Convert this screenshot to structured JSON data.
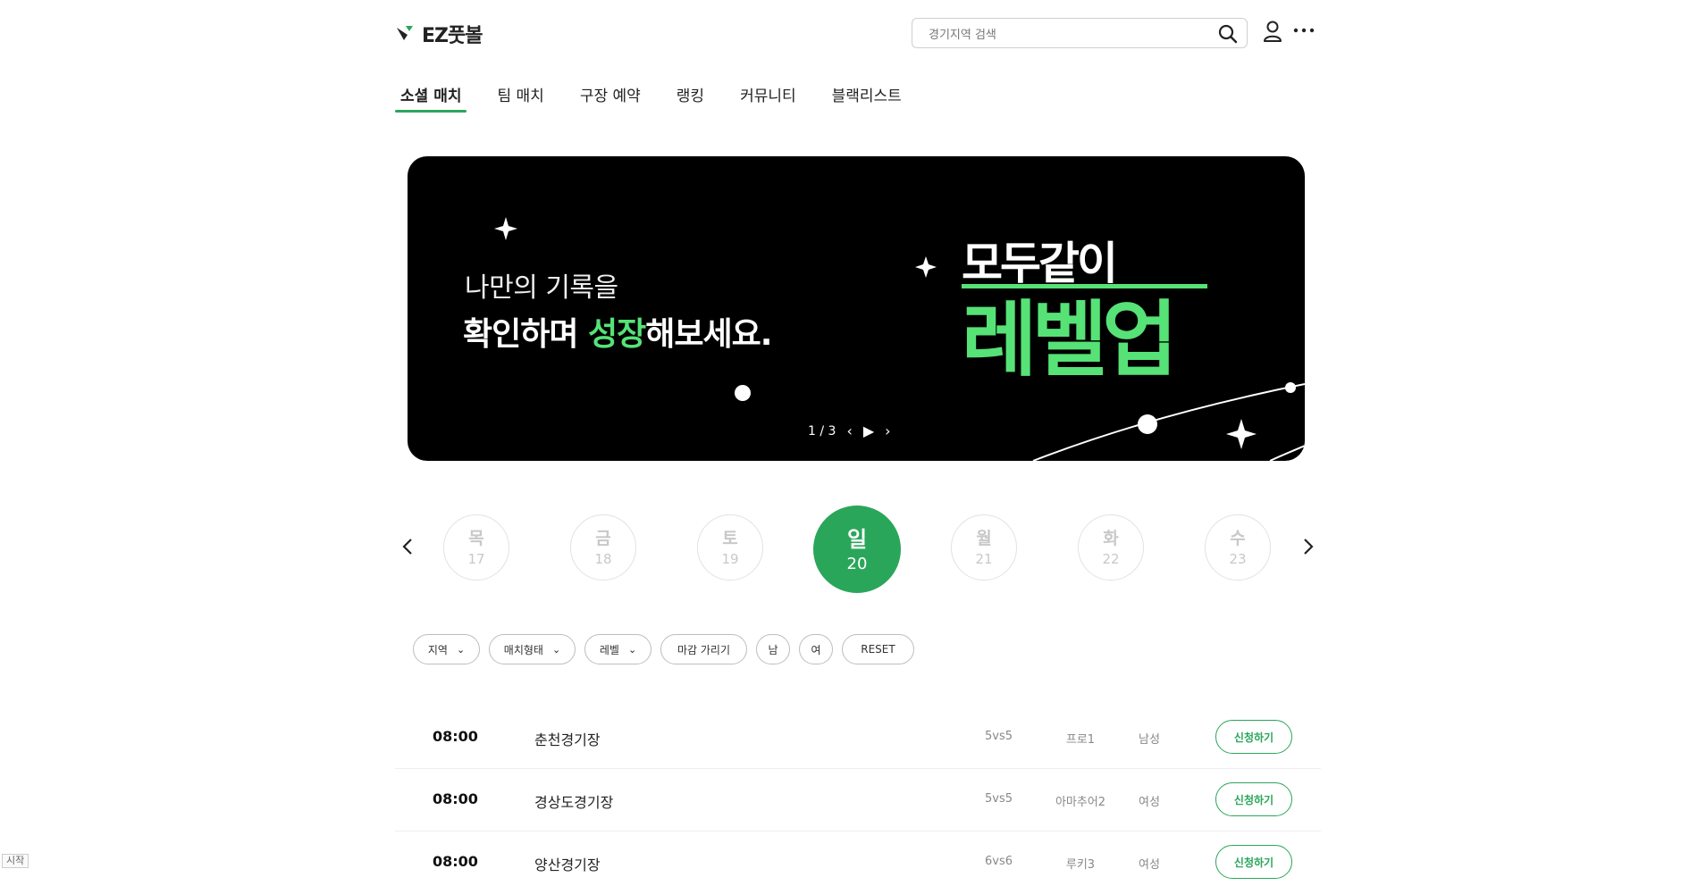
{
  "header": {
    "logo": "EZ풋볼",
    "search_placeholder": "경기지역 검색"
  },
  "nav": [
    "소셜 매치",
    "팀 매치",
    "구장 예약",
    "랭킹",
    "커뮤니티",
    "블랙리스트"
  ],
  "banner": {
    "line1": "나만의 기록을",
    "line2_pre": "확인하며 ",
    "line2_hl": "성장",
    "line2_post": "해보세요.",
    "title1": "모두같이",
    "title2": "레벨업",
    "counter": "1 / 3",
    "accent": "#56e276"
  },
  "dates": [
    {
      "dow": "목",
      "num": "17"
    },
    {
      "dow": "금",
      "num": "18"
    },
    {
      "dow": "토",
      "num": "19"
    },
    {
      "dow": "일",
      "num": "20"
    },
    {
      "dow": "월",
      "num": "21"
    },
    {
      "dow": "화",
      "num": "22"
    },
    {
      "dow": "수",
      "num": "23"
    }
  ],
  "filters": {
    "region": "지역",
    "match_type": "매치형태",
    "level": "레벨",
    "hide_closed": "마감 가리기",
    "male": "남",
    "female": "여",
    "reset": "RESET"
  },
  "matches": [
    {
      "time": "08:00",
      "stadium": "춘천경기장",
      "format": "5vs5",
      "level": "프로1",
      "gender": "남성",
      "action": "신청하기"
    },
    {
      "time": "08:00",
      "stadium": "경상도경기장",
      "format": "5vs5",
      "level": "아마추어2",
      "gender": "여성",
      "action": "신청하기"
    },
    {
      "time": "08:00",
      "stadium": "양산경기장",
      "format": "6vs6",
      "level": "루키3",
      "gender": "여성",
      "action": "신청하기"
    }
  ],
  "taskbar": {
    "start": "시작"
  },
  "colors": {
    "brand": "#2aa65a"
  }
}
